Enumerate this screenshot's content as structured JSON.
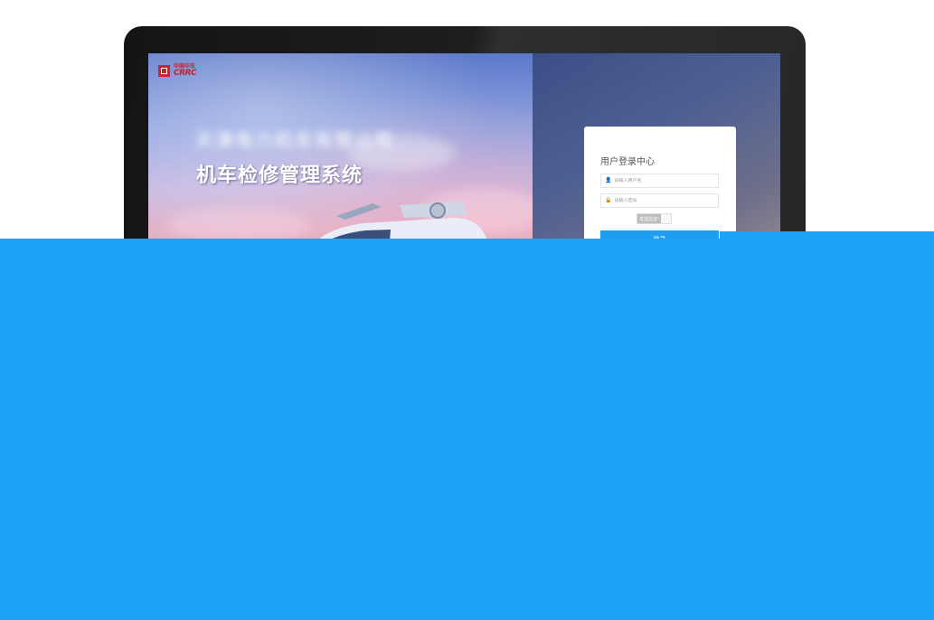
{
  "brand": {
    "logo_cn": "中国中车",
    "logo_en": "CRRC",
    "company": "天津电力机车有限公司"
  },
  "hero": {
    "system_title": "机车检修管理系统"
  },
  "login": {
    "title": "用户登录中心",
    "username_placeholder": "请输入用户名",
    "password_placeholder": "请输入密码",
    "captcha_label": "发送验证",
    "submit_label": "登录"
  },
  "colors": {
    "accent": "#1ea2f5",
    "logo_red": "#c8232a"
  },
  "icons": {
    "user": "user-icon",
    "lock": "lock-icon",
    "arrow": "chevron-right-icon"
  }
}
